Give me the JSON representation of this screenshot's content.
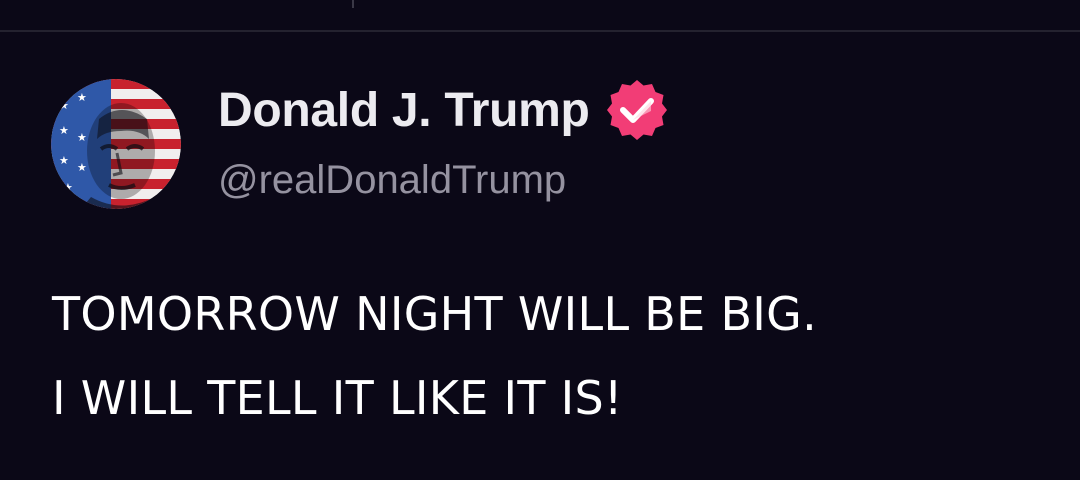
{
  "post": {
    "author": {
      "display_name": "Donald J. Trump",
      "handle": "@realDonaldTrump",
      "verified": true,
      "avatar_icon": "flag-portrait-avatar",
      "verified_icon": "verified-badge-icon",
      "verified_color": "#f23d76"
    },
    "content_lines": [
      "TOMORROW NIGHT WILL BE BIG.",
      "I WILL TELL IT LIKE IT IS!"
    ]
  },
  "colors": {
    "background": "#0b0817",
    "divider": "#24222f",
    "name": "#ecebf0",
    "handle": "#9592a0",
    "text": "#ffffff"
  }
}
